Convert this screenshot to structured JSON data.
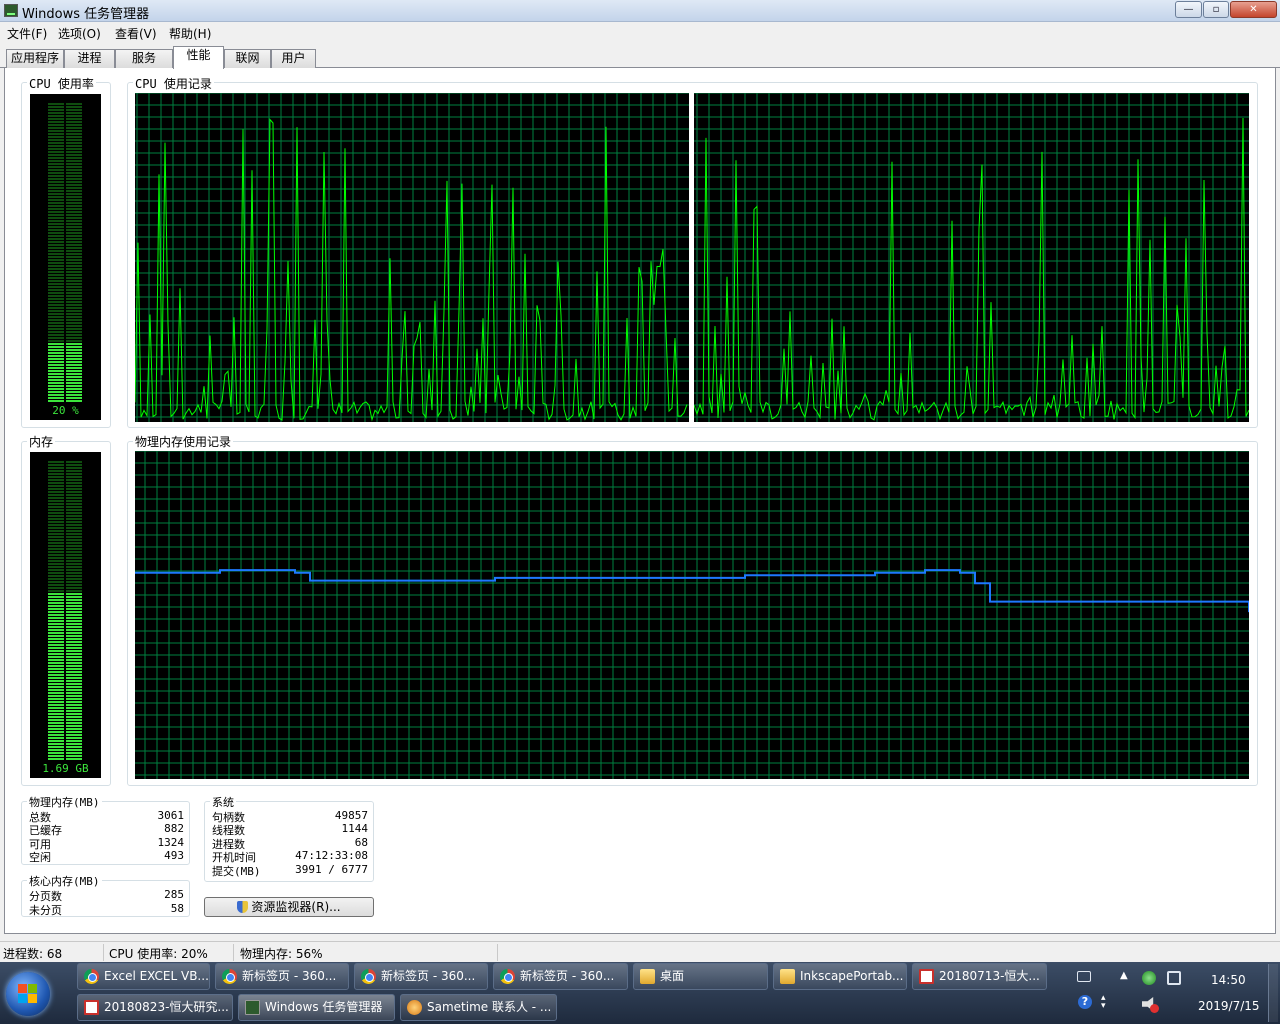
{
  "window": {
    "title": "Windows 任务管理器",
    "controls": {
      "minimize": "—",
      "maximize": "▫",
      "close": "✕"
    }
  },
  "menu": [
    "文件(F)",
    "选项(O)",
    "查看(V)",
    "帮助(H)"
  ],
  "tabs": [
    {
      "label": "应用程序",
      "active": false
    },
    {
      "label": "进程",
      "active": false
    },
    {
      "label": "服务",
      "active": false
    },
    {
      "label": "性能",
      "active": true
    },
    {
      "label": "联网",
      "active": false
    },
    {
      "label": "用户",
      "active": false
    }
  ],
  "cpu_usage": {
    "label": "CPU 使用率",
    "value_text": "20 %",
    "percent": 20
  },
  "cpu_history": {
    "label": "CPU 使用记录",
    "cores": 2
  },
  "memory": {
    "label": "内存",
    "value_text": "1.69 GB",
    "percent": 56
  },
  "memory_history": {
    "label": "物理内存使用记录"
  },
  "physical_memory": {
    "label": "物理内存(MB)",
    "rows": [
      {
        "label": "总数",
        "value": "3061"
      },
      {
        "label": "已缓存",
        "value": "882"
      },
      {
        "label": "可用",
        "value": "1324"
      },
      {
        "label": "空闲",
        "value": "493"
      }
    ]
  },
  "kernel_memory": {
    "label": "核心内存(MB)",
    "rows": [
      {
        "label": "分页数",
        "value": "285"
      },
      {
        "label": "未分页",
        "value": "58"
      }
    ]
  },
  "system": {
    "label": "系统",
    "rows": [
      {
        "label": "句柄数",
        "value": "49857"
      },
      {
        "label": "线程数",
        "value": "1144"
      },
      {
        "label": "进程数",
        "value": "68"
      },
      {
        "label": "开机时间",
        "value": "47:12:33:08"
      },
      {
        "label": "提交(MB)",
        "value": "3991 / 6777"
      }
    ]
  },
  "resource_monitor_button": "资源监视器(R)...",
  "statusbar": {
    "processes": "进程数: 68",
    "cpu": "CPU 使用率: 20%",
    "memory": "物理内存: 56%"
  },
  "taskbar": {
    "row1": [
      {
        "label": "Excel EXCEL VB...",
        "icon": "chrome-icon"
      },
      {
        "label": "新标签页 - 360...",
        "icon": "chrome-icon"
      },
      {
        "label": "新标签页 - 360...",
        "icon": "chrome-icon"
      },
      {
        "label": "新标签页 - 360...",
        "icon": "chrome-icon"
      },
      {
        "label": "桌面",
        "icon": "folder-icon"
      },
      {
        "label": "InkscapePortab...",
        "icon": "folder-icon"
      },
      {
        "label": "20180713-恒大...",
        "icon": "pdf-icon"
      }
    ],
    "row2": [
      {
        "label": "20180823-恒大研究...",
        "icon": "pdf-icon"
      },
      {
        "label": "Windows 任务管理器",
        "icon": "taskmgr-icon",
        "active": true
      },
      {
        "label": "Sametime 联系人 - ...",
        "icon": "sametime-icon"
      }
    ],
    "clock_time": "14:50",
    "clock_date": "2019/7/15"
  },
  "colors": {
    "graph_bg": "#000000",
    "graph_grid": "#008040",
    "cpu_line": "#00ff00",
    "mem_line": "#1e78ff",
    "gauge_on": "#3ce63c",
    "gauge_off": "#0f4d0f"
  }
}
